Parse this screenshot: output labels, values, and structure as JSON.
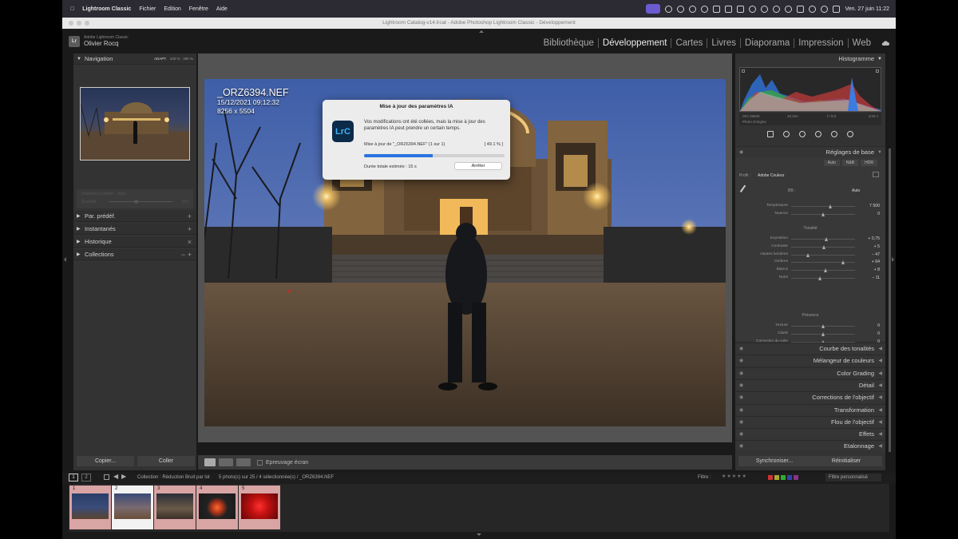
{
  "menubar": {
    "app_name": "Lightroom Classic",
    "menus": [
      "Fichier",
      "Edition",
      "Fenêtre",
      "Aide"
    ],
    "datetime": "Ven. 27 juin  11:22"
  },
  "window": {
    "title": "Lightroom Catalog-v14.lrcat - Adobe Photoshop Lightroom Classic - Développement"
  },
  "identity": {
    "product": "Adobe Lightroom Classic",
    "user": "Olivier Rocq"
  },
  "modules": [
    "Bibliothèque",
    "Développement",
    "Cartes",
    "Livres",
    "Diaporama",
    "Impression",
    "Web"
  ],
  "active_module": "Développement",
  "left_panel": {
    "navigator": {
      "title": "Navigation",
      "zoom_options": [
        "ADAPT.",
        "100 %",
        "400 %"
      ]
    },
    "preset_faded": "Traitement prédéf. : Style",
    "preset_amount_label": "Quantité",
    "preset_amount_value": "100",
    "sections": [
      "Par. prédéf.",
      "Instantanés",
      "Historique",
      "Collections"
    ],
    "copy_label": "Copier...",
    "paste_label": "Coller"
  },
  "photo_overlay": {
    "filename": "_ORZ6394.NEF",
    "datetime": "15/12/2021 09:12:32",
    "dimensions": "8256 x 5504"
  },
  "toolbar": {
    "softproof_label": "Epreuvage écran"
  },
  "dialog": {
    "title": "Mise à jour des paramètres IA",
    "logo_text": "LrC",
    "message": "Vos modifications ont été collées, mais la mise à jour des paramètres IA peut prendre un certain temps.",
    "progress_text": "Mise à jour de \"_ORZ6394.NEF\" (1 sur 1)",
    "progress_pct": "[ 49.1 % ]",
    "progress_value": 49.1,
    "eta": "Durée totale estimée : 15 s",
    "stop_label": "Arrêter"
  },
  "right_panel": {
    "histogram_title": "Histogramme",
    "hist_info": {
      "iso": "ISO 25600",
      "focal": "16 mm",
      "aperture": "f / 8,0",
      "shutter": "1/40 s"
    },
    "original_photo_label": "Photo d'origine",
    "basic_title": "Réglages de base",
    "treatment_modes": [
      "Auto",
      "N&B",
      "HDR"
    ],
    "profile_label": "Profil :",
    "profile_value": "Adobe Couleur",
    "wb_label": "BB :",
    "wb_value": "Auto",
    "sliders_wb": [
      {
        "label": "Température",
        "value": "7 500",
        "pos": 0.62
      },
      {
        "label": "Nuance",
        "value": "0",
        "pos": 0.5
      }
    ],
    "tone_title": "Tonalité",
    "sliders_tone": [
      {
        "label": "Exposition",
        "value": "+ 0,75",
        "pos": 0.56
      },
      {
        "label": "Contraste",
        "value": "+ 5",
        "pos": 0.52
      },
      {
        "label": "Hautes lumières",
        "value": "− 47",
        "pos": 0.27
      },
      {
        "label": "Ombres",
        "value": "+ 64",
        "pos": 0.82
      },
      {
        "label": "Blancs",
        "value": "+ 8",
        "pos": 0.54
      },
      {
        "label": "Noirs",
        "value": "− 11",
        "pos": 0.45
      }
    ],
    "presence_title": "Présence",
    "sliders_presence": [
      {
        "label": "Texture",
        "value": "0",
        "pos": 0.5
      },
      {
        "label": "Clarté",
        "value": "0",
        "pos": 0.5
      },
      {
        "label": "Correction du voile",
        "value": "0",
        "pos": 0.5
      },
      {
        "label": "Vibrance",
        "value": "+ 14",
        "pos": 0.57
      },
      {
        "label": "Saturation",
        "value": "− 2",
        "pos": 0.49
      }
    ],
    "sections": [
      "Courbe des tonalités",
      "Mélangeur de couleurs",
      "Color Grading",
      "Détail",
      "Corrections de l'objectif",
      "Transformation",
      "Flou de l'objectif",
      "Effets",
      "Etalonnage"
    ],
    "sync_label": "Synchroniser...",
    "reset_label": "Réinitialiser"
  },
  "filmbar": {
    "pages": [
      "1",
      "2"
    ],
    "collection_text": "Collection : Réduction Bruit par lot",
    "selection_text": "5 photo(s) sur 25 / 4 sélectionnée(s) / _ORZ6394.NEF",
    "filter_label": "Filtre :",
    "filter_value": "Filtre personnalisé"
  },
  "filmstrip": [
    {
      "num": "1"
    },
    {
      "num": "2"
    },
    {
      "num": "3"
    },
    {
      "num": "4"
    },
    {
      "num": "5"
    }
  ],
  "colors": {
    "accent": "#2a73e0",
    "selected_cell": "#f2f2f2",
    "picked_cell": "#d9a4a4"
  }
}
